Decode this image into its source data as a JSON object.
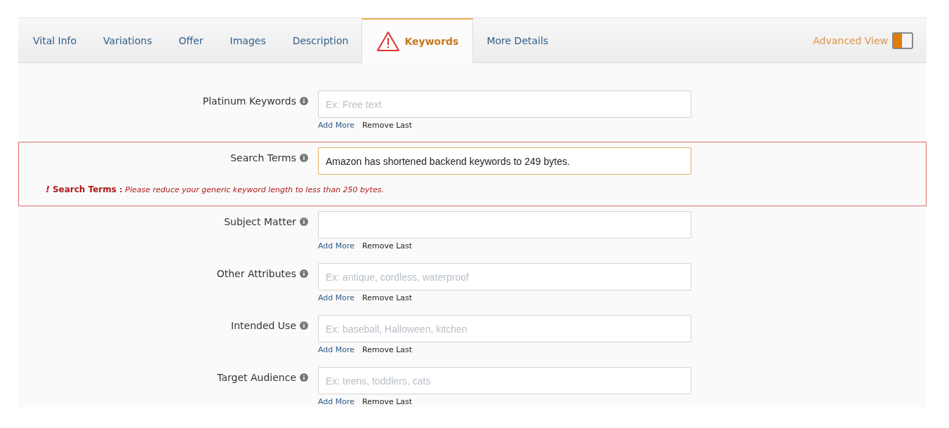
{
  "tabs": [
    {
      "label": "Vital Info",
      "selected": false,
      "warning": false
    },
    {
      "label": "Variations",
      "selected": false,
      "warning": false
    },
    {
      "label": "Offer",
      "selected": false,
      "warning": false
    },
    {
      "label": "Images",
      "selected": false,
      "warning": false
    },
    {
      "label": "Description",
      "selected": false,
      "warning": false
    },
    {
      "label": "Keywords",
      "selected": true,
      "warning": true
    },
    {
      "label": "More Details",
      "selected": false,
      "warning": false
    }
  ],
  "advanced_view": {
    "label": "Advanced View",
    "on": true
  },
  "fields": [
    {
      "label": "Platinum Keywords",
      "placeholder": "Ex: Free text",
      "add_more": "Add More",
      "remove_last": "Remove Last"
    },
    {
      "label": "Search Terms",
      "value": "Amazon has shortened backend keywords to 249 bytes.",
      "error": {
        "mark": "!",
        "field": "Search Terms",
        "separator": ":",
        "message": "Please reduce your generic keyword length to less than 250 bytes."
      }
    },
    {
      "label": "Subject Matter",
      "add_more": "Add More",
      "remove_last": "Remove Last"
    },
    {
      "label": "Other Attributes",
      "placeholder": "Ex: antique, cordless, waterproof",
      "add_more": "Add More",
      "remove_last": "Remove Last"
    },
    {
      "label": "Intended Use",
      "placeholder": "Ex: baseball, Halloween, kitchen",
      "add_more": "Add More",
      "remove_last": "Remove Last"
    },
    {
      "label": "Target Audience",
      "placeholder": "Ex: teens, toddlers, cats",
      "add_more": "Add More",
      "remove_last": "Remove Last"
    }
  ]
}
